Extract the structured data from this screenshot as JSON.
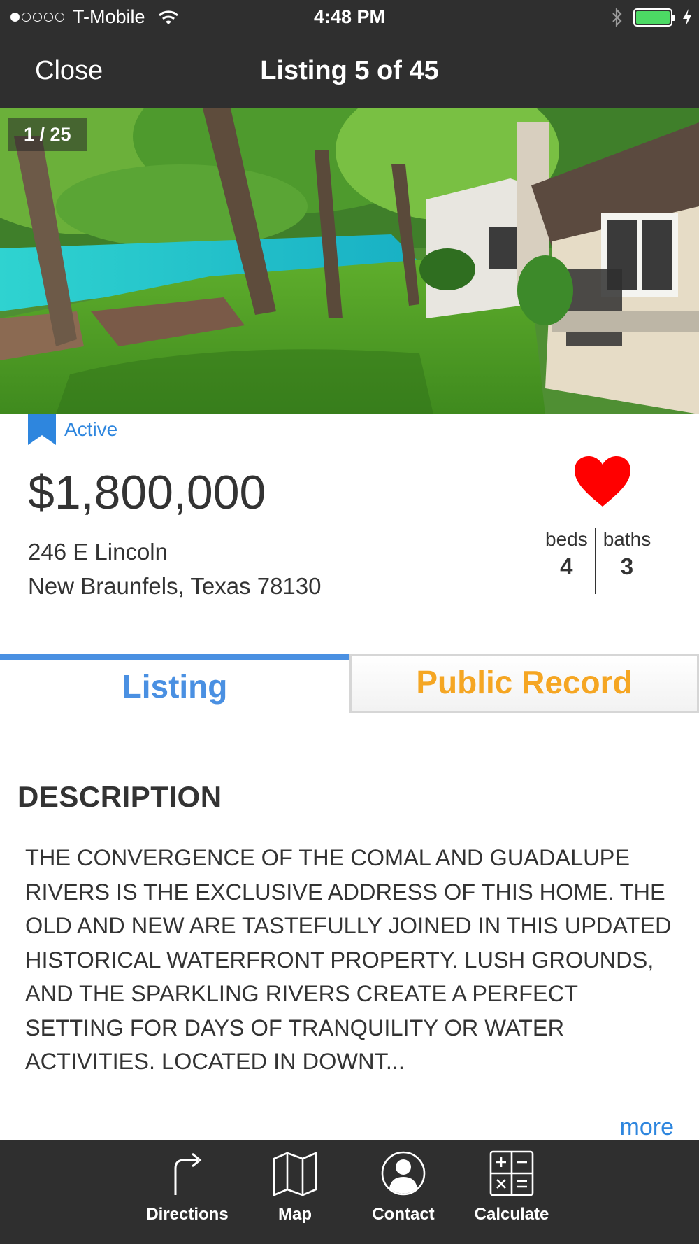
{
  "status_bar": {
    "carrier": "T-Mobile",
    "time": "4:48 PM"
  },
  "nav": {
    "close_label": "Close",
    "title": "Listing 5 of 45"
  },
  "photo": {
    "counter": "1 / 25"
  },
  "listing": {
    "status": "Active",
    "price": "$1,800,000",
    "address_line1": "246 E Lincoln",
    "address_line2": "New Braunfels, Texas 78130",
    "beds_label": "beds",
    "beds_value": "4",
    "baths_label": "baths",
    "baths_value": "3",
    "favorited": true
  },
  "tabs": {
    "listing_label": "Listing",
    "public_record_label": "Public Record",
    "active": "Listing"
  },
  "description": {
    "heading": "DESCRIPTION",
    "text": "THE CONVERGENCE OF THE COMAL AND GUADALUPE RIVERS IS THE EXCLUSIVE ADDRESS OF THIS HOME. THE OLD AND NEW ARE TASTEFULLY JOINED IN THIS UPDATED HISTORICAL WATERFRONT PROPERTY. LUSH GROUNDS, AND THE SPARKLING RIVERS CREATE A PERFECT SETTING FOR DAYS OF TRANQUILITY OR WATER ACTIVITIES. LOCATED IN DOWNT...",
    "more_label": "more"
  },
  "toolbar": {
    "directions_label": "Directions",
    "map_label": "Map",
    "contact_label": "Contact",
    "calculate_label": "Calculate"
  },
  "colors": {
    "bar_background": "#2f2f2f",
    "accent_blue": "#4a90e2",
    "accent_orange": "#f5a623",
    "heart_red": "#ff0000",
    "battery_green": "#4cd964"
  },
  "icons": {
    "wifi": "wifi-icon",
    "bluetooth": "bluetooth-icon",
    "battery": "battery-icon",
    "charging": "charging-bolt-icon",
    "status_tag": "bookmark-icon",
    "favorite": "heart-icon",
    "directions": "turn-arrow-icon",
    "map": "folded-map-icon",
    "contact": "person-icon",
    "calculate": "calculator-icon"
  }
}
